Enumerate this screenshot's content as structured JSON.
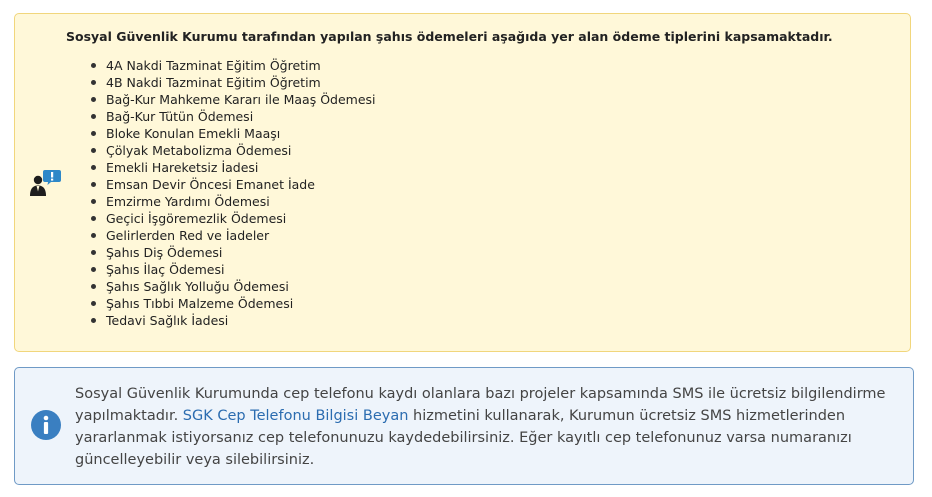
{
  "payment_notice": {
    "icon": "user-alert-icon",
    "title": "Sosyal Güvenlik Kurumu tarafından yapılan şahıs ödemeleri aşağıda yer alan ödeme tiplerini kapsamaktadır.",
    "items": [
      "4A Nakdi Tazminat Eğitim Öğretim",
      "4B Nakdi Tazminat Eğitim Öğretim",
      "Bağ-Kur Mahkeme Kararı ile Maaş Ödemesi",
      "Bağ-Kur Tütün Ödemesi",
      "Bloke Konulan Emekli Maaşı",
      "Çölyak Metabolizma Ödemesi",
      "Emekli Hareketsiz İadesi",
      "Emsan Devir Öncesi Emanet İade",
      "Emzirme Yardımı Ödemesi",
      "Geçici İşgöremezlik Ödemesi",
      "Gelirlerden Red ve İadeler",
      "Şahıs Diş Ödemesi",
      "Şahıs İlaç Ödemesi",
      "Şahıs Sağlık Yolluğu Ödemesi",
      "Şahıs Tıbbi Malzeme Ödemesi",
      "Tedavi Sağlık İadesi"
    ],
    "colors": {
      "background": "#fff8d9",
      "border": "#f1d67c",
      "icon_accent": "#2e88c8"
    }
  },
  "sms_info": {
    "icon": "info-icon",
    "text_before": "Sosyal Güvenlik Kurumunda cep telefonu kaydı olanlara bazı projeler kapsamında SMS ile ücretsiz bilgilendirme yapılmaktadır. ",
    "link_text": "SGK Cep Telefonu Bilgisi Beyan",
    "text_after": " hizmetini kullanarak, Kurumun ücretsiz SMS hizmetlerinden yararlanmak istiyorsanız cep telefonunuzu kaydedebilirsiniz. Eğer kayıtlı cep telefonunuz varsa numaranızı güncelleyebilir veya silebilirsiniz.",
    "colors": {
      "background": "#eef4fb",
      "border": "#6f9ac6",
      "icon": "#3a7fc1",
      "link": "#2b6cb0"
    }
  }
}
